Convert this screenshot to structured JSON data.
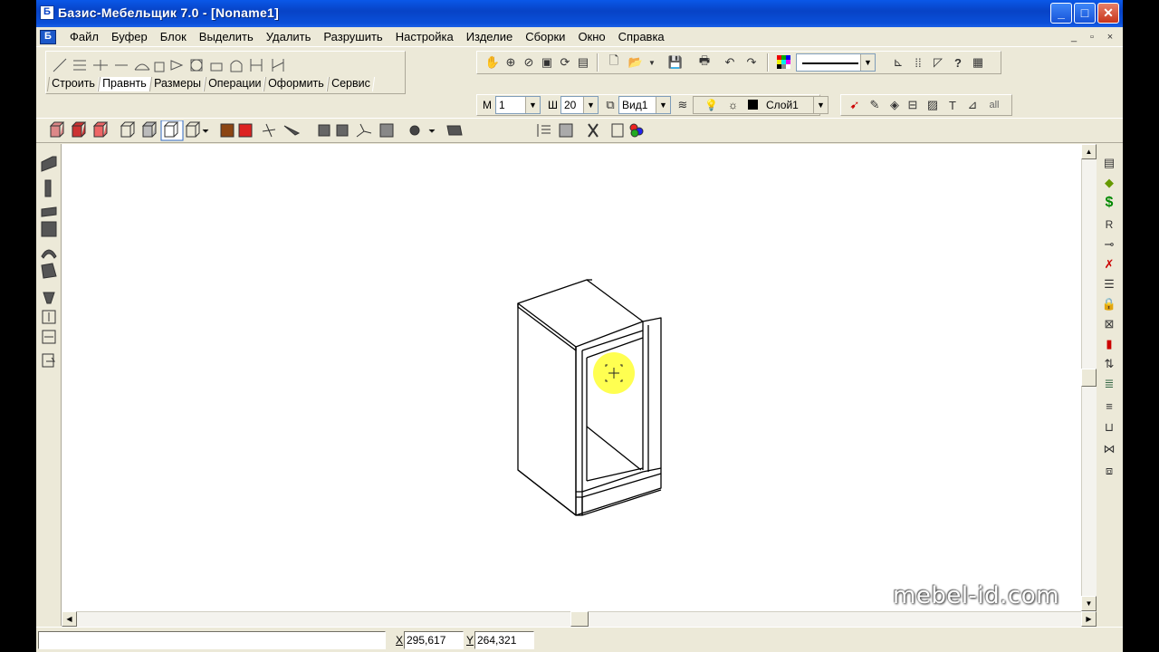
{
  "window": {
    "title": "Базис-Мебельщик 7.0 - [Noname1]",
    "controls": {
      "minimize": "_",
      "maximize": "□",
      "close": "✕"
    }
  },
  "menu": {
    "items": [
      "Файл",
      "Буфер",
      "Блок",
      "Выделить",
      "Удалить",
      "Разрушить",
      "Настройка",
      "Изделие",
      "Сборки",
      "Окно",
      "Справка"
    ],
    "mdi_controls": [
      "_",
      "▫",
      "×"
    ]
  },
  "tabs": [
    "Строить",
    "Правнть",
    "Размеры",
    "Операции",
    "Оформить",
    "Сервис"
  ],
  "properties_bar": {
    "m_label": "М",
    "m_value": "1",
    "w_label": "Ш",
    "w_value": "20",
    "view_value": "Вид1",
    "layer_value": "Слой1",
    "all_label": "all"
  },
  "status": {
    "x_label": "X",
    "x_value": "295,617",
    "y_label": "Y",
    "y_value": "264,321"
  },
  "watermark": "mebel-id.com",
  "right_tools": {
    "dollar": "$",
    "r": "R"
  },
  "colors": {
    "titlebar": "#0a58e8",
    "face": "#ece9d8",
    "cursor_halo": "#ffff33"
  }
}
